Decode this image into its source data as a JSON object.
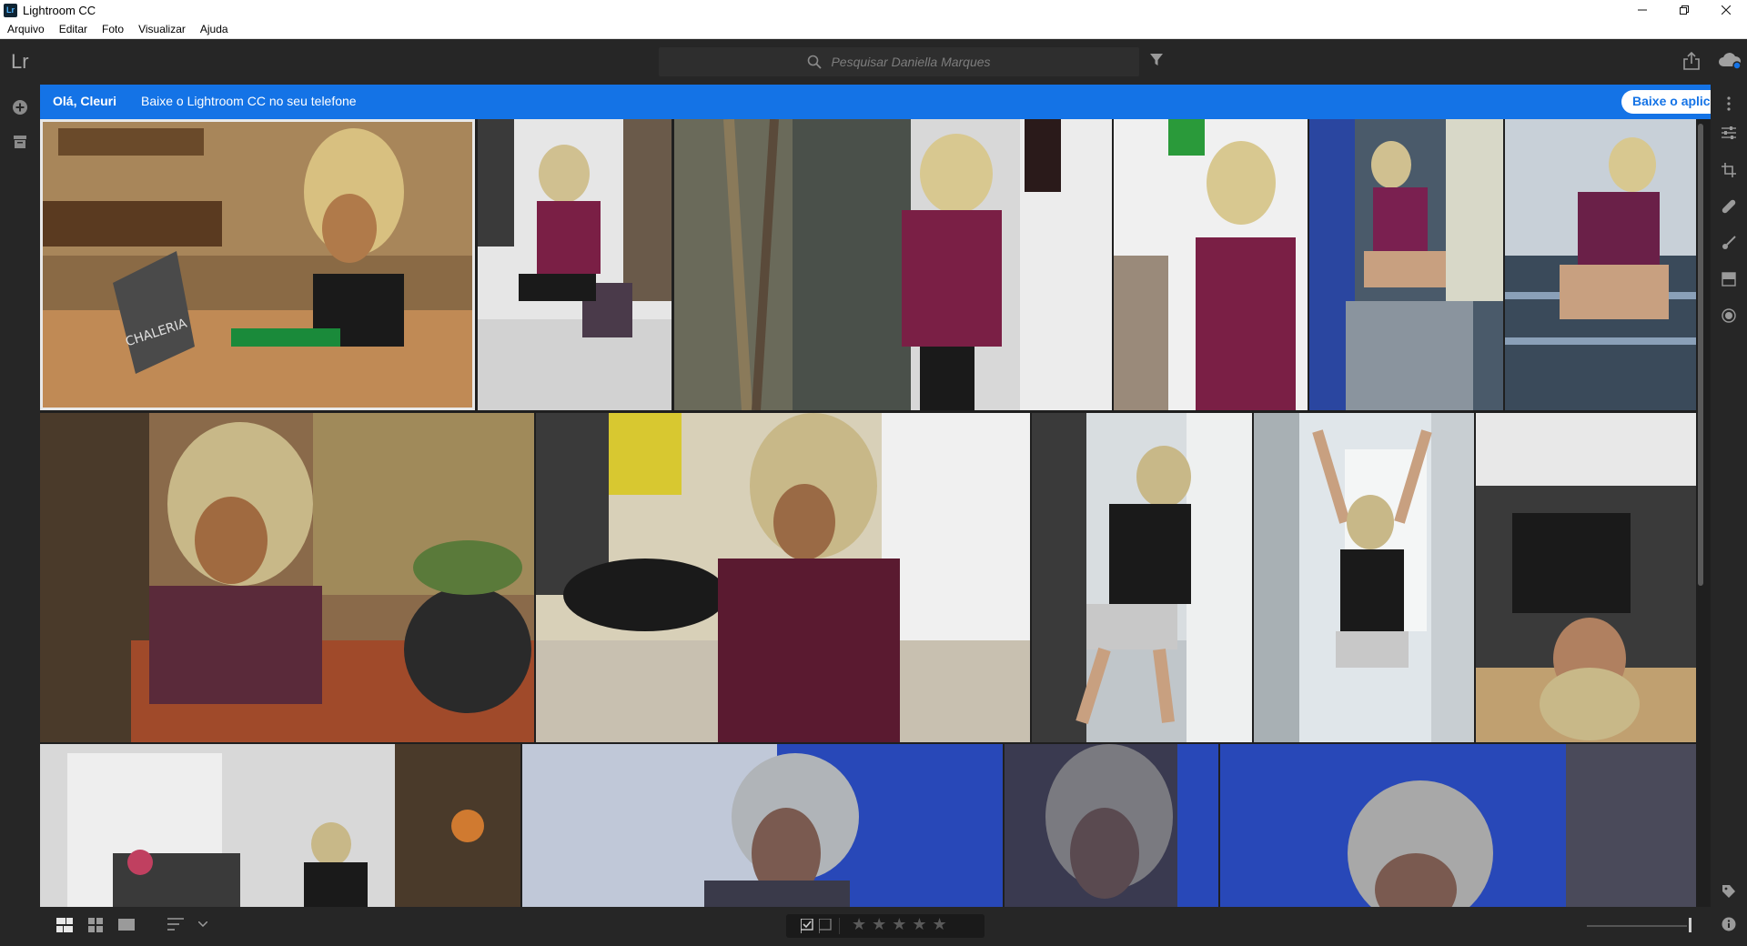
{
  "window": {
    "title": "Lightroom CC",
    "app_badge": "Lr"
  },
  "menu": [
    "Arquivo",
    "Editar",
    "Foto",
    "Visualizar",
    "Ajuda"
  ],
  "appbar": {
    "logo": "Lr",
    "search_placeholder": "Pesquisar Daniella Marques"
  },
  "banner": {
    "greeting": "Olá, Cleuri",
    "message": "Baixe o Lightroom CC no seu telefone",
    "button": "Baixe o aplic"
  },
  "colors": {
    "accent": "#1473e6",
    "bg": "#1f1f1f",
    "panel": "#262626"
  },
  "photos_row1": [
    {
      "theme": "cafe-chaleria",
      "colors": [
        "#8a6a45",
        "#b08a5c",
        "#3a2a18"
      ],
      "selected": true,
      "sign": "CHALERIA"
    },
    {
      "theme": "stool-white-room",
      "colors": [
        "#e6e6e6",
        "#7a1f45",
        "#c8c8c8"
      ]
    },
    {
      "theme": "plant-wall",
      "colors": [
        "#5a5a4a",
        "#d8d8d8",
        "#7a1f45"
      ]
    },
    {
      "theme": "wall-lean",
      "colors": [
        "#f0f0f0",
        "#7a1f45",
        "#9a8a7a"
      ]
    },
    {
      "theme": "stairs-hammock",
      "colors": [
        "#4a5a6a",
        "#7a2050",
        "#2a46a0"
      ]
    },
    {
      "theme": "stairs-sit",
      "colors": [
        "#8aa0b8",
        "#6a2048",
        "#3a4a5a"
      ]
    }
  ],
  "photos_row2": [
    {
      "theme": "flowers-table",
      "colors": [
        "#6a3a1a",
        "#a04a2a",
        "#5a2a3a"
      ]
    },
    {
      "theme": "black-table",
      "colors": [
        "#c8c0a8",
        "#5a1a30",
        "#1a1a1a"
      ]
    },
    {
      "theme": "door-lean",
      "colors": [
        "#d8dde0",
        "#1a1a1a",
        "#b8bcc0"
      ]
    },
    {
      "theme": "arms-up",
      "colors": [
        "#e0e6ea",
        "#1a1a1a",
        "#c0c6ca"
      ]
    },
    {
      "theme": "lying-couch",
      "colors": [
        "#3a3a3a",
        "#1a1a1a",
        "#c8a080"
      ]
    }
  ],
  "photos_row3": [
    {
      "theme": "room-plants",
      "colors": [
        "#d8d8d8",
        "#3a3a3a",
        "#c04060"
      ]
    },
    {
      "theme": "hammock-1",
      "colors": [
        "#c0c8d8",
        "#2848b8",
        "#3a3a4a"
      ]
    },
    {
      "theme": "hammock-2",
      "colors": [
        "#3a3a50",
        "#2848b8",
        "#5a5a70"
      ]
    },
    {
      "theme": "hammock-3",
      "colors": [
        "#d0d4dc",
        "#2848b8",
        "#4a4a5a"
      ]
    }
  ],
  "bottombar": {
    "stars": "★★★★★"
  }
}
